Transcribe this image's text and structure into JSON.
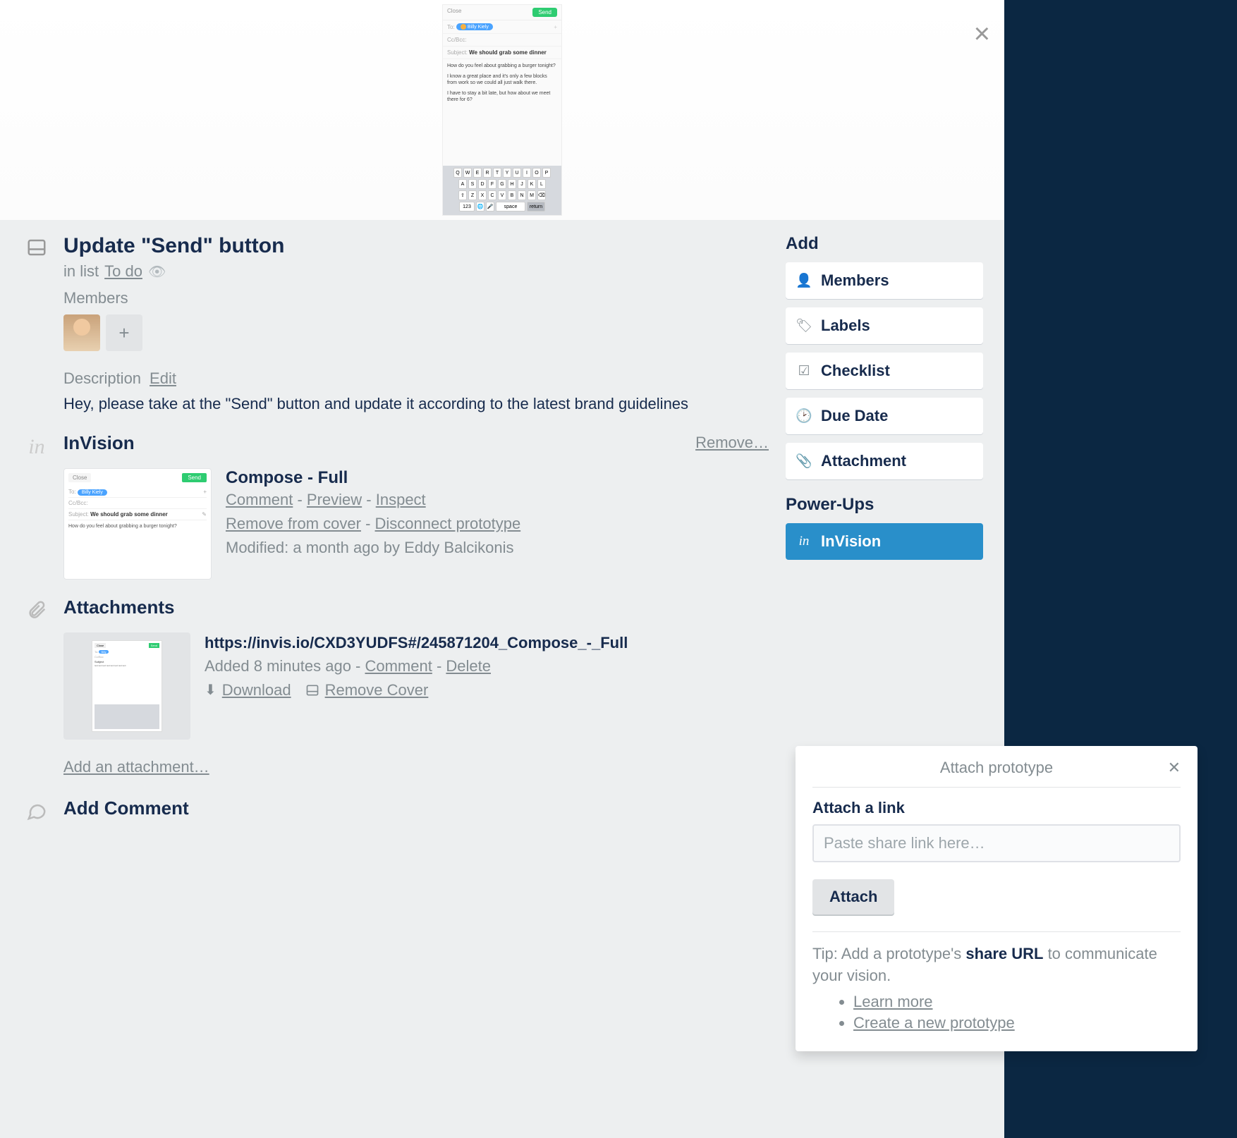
{
  "cover": {
    "close_btn": "Close",
    "send_btn": "Send",
    "to_label": "To:",
    "recipient": "Billy Kiely",
    "cc_label": "Cc/Bcc:",
    "subject_label": "Subject:",
    "subject": "We should grab some dinner",
    "body1": "How do you feel about grabbing a burger tonight?",
    "body2": "I know a great place and it's only a few blocks from work so we could all just walk there.",
    "body3": "I have to stay a bit late, but how about we meet there for 6?",
    "kb_r1": [
      "Q",
      "W",
      "E",
      "R",
      "T",
      "Y",
      "U",
      "I",
      "O",
      "P"
    ],
    "kb_r2": [
      "A",
      "S",
      "D",
      "F",
      "G",
      "H",
      "J",
      "K",
      "L"
    ],
    "kb_r3": [
      "⇧",
      "Z",
      "X",
      "C",
      "V",
      "B",
      "N",
      "M",
      "⌫"
    ],
    "kb_123": "123",
    "kb_globe": "🌐",
    "kb_mic": "🎤",
    "kb_space": "space",
    "kb_ret": "return"
  },
  "card": {
    "title": "Update \"Send\" button",
    "list_prefix": "in list ",
    "list_name": "To do"
  },
  "members": {
    "label": "Members"
  },
  "description": {
    "label": "Description",
    "edit": "Edit",
    "text": "Hey, please take at the \"Send\" button and update it according to the latest brand guidelines"
  },
  "invision": {
    "title": "InVision",
    "remove": "Remove…",
    "item_name": "Compose - Full",
    "comment": "Comment",
    "preview": "Preview",
    "inspect": "Inspect",
    "remove_cover": "Remove from cover",
    "disconnect": "Disconnect prototype",
    "modified": "Modified: a month ago by Eddy Balcikonis"
  },
  "attachments": {
    "title": "Attachments",
    "name": "https://invis.io/CXD3YUDFS#/245871204_Compose_-_Full",
    "added": "Added 8 minutes ago - ",
    "comment": "Comment",
    "delete": "Delete",
    "download": "Download",
    "remove_cover": "Remove Cover",
    "add": "Add an attachment…"
  },
  "add_comment": {
    "title": "Add Comment"
  },
  "sidebar": {
    "add_title": "Add",
    "members": "Members",
    "labels": "Labels",
    "checklist": "Checklist",
    "due_date": "Due Date",
    "attachment": "Attachment",
    "powerups_title": "Power-Ups",
    "invision": "InVision"
  },
  "popover": {
    "title": "Attach prototype",
    "label": "Attach a link",
    "placeholder": "Paste share link here…",
    "button": "Attach",
    "tip_pre": "Tip: Add a prototype's ",
    "tip_bold": "share URL",
    "tip_post": " to communicate your vision.",
    "learn": "Learn more",
    "create": "Create a new prototype"
  }
}
